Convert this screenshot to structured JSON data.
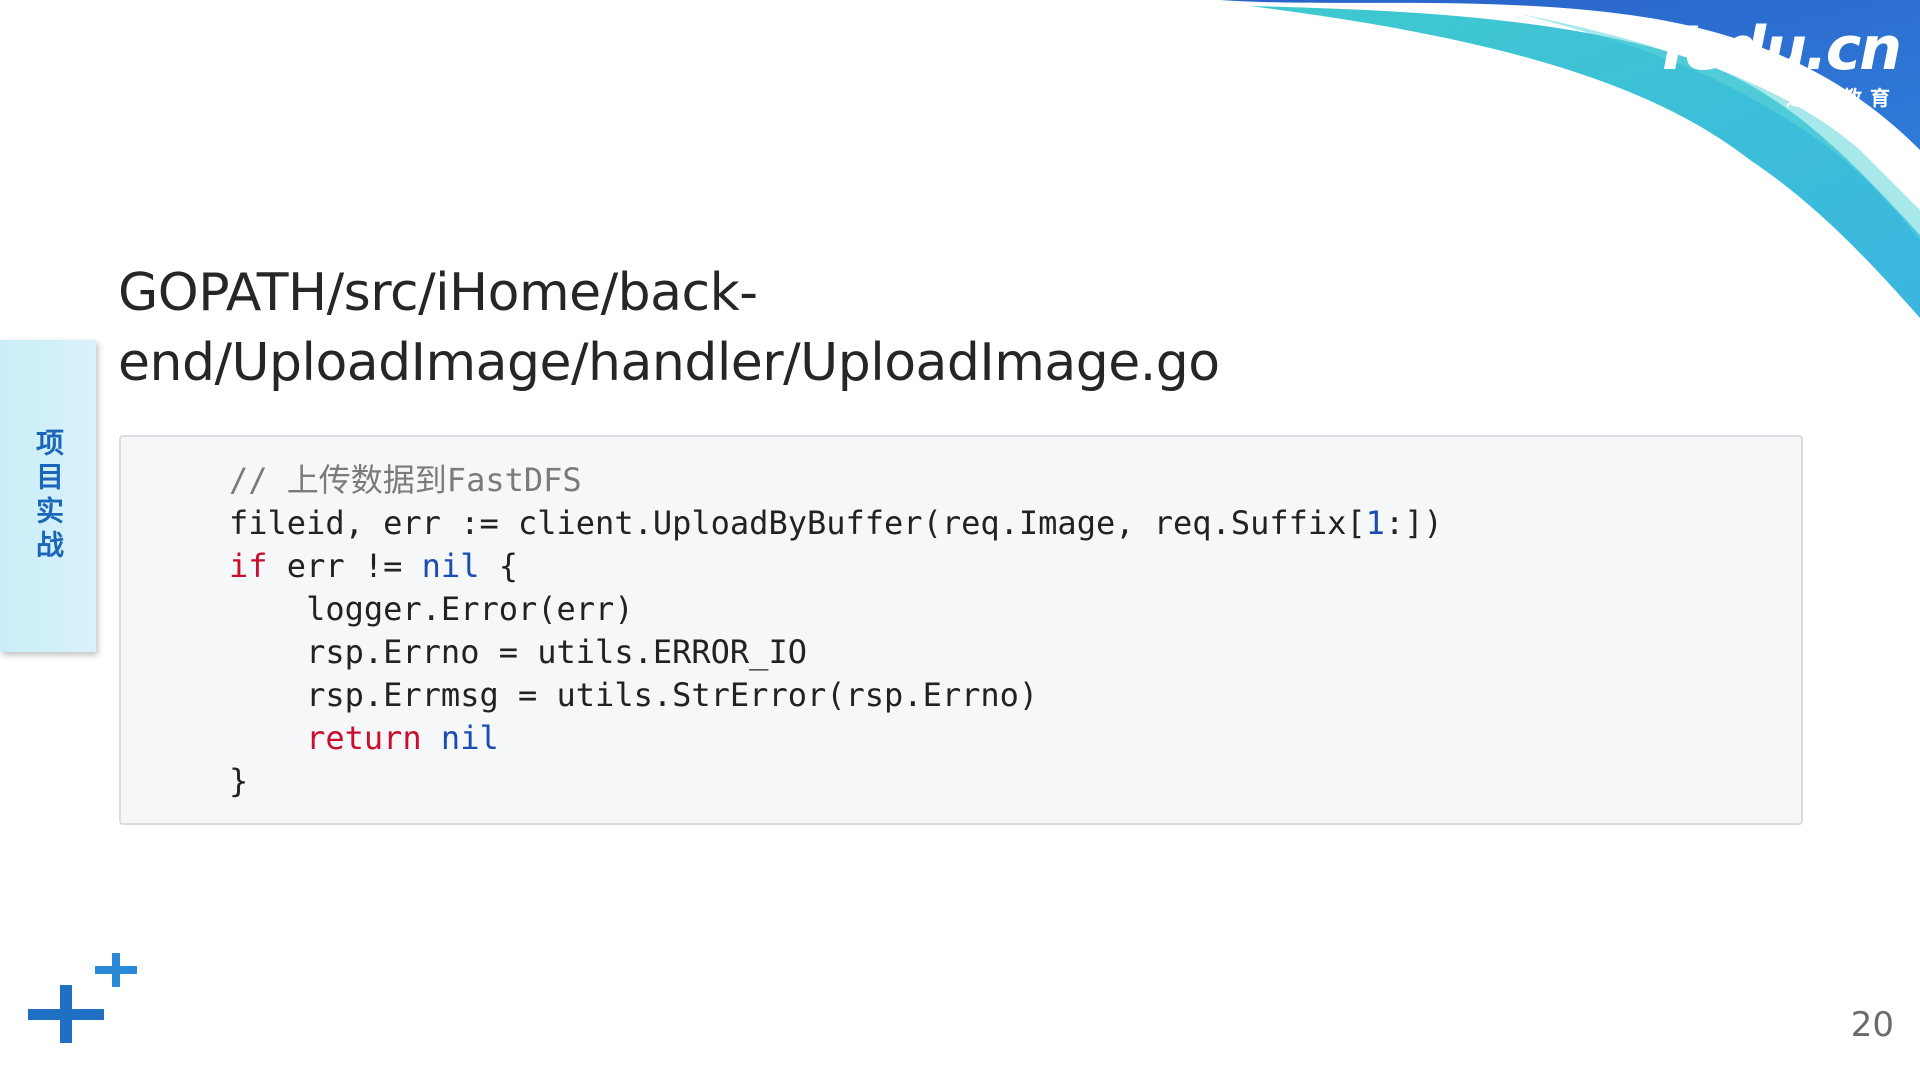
{
  "brand": {
    "logo_text": "Tedu.cn",
    "logo_subtitle": "达内教育",
    "colors": [
      "#2f6fd1",
      "#3ec6d2",
      "#35b8e0"
    ]
  },
  "side_tab": {
    "label": "项目实战",
    "color": "#1b66b8"
  },
  "slide": {
    "title_line1": "GOPATH/src/iHome/back-",
    "title_line2": "end/UploadImage/handler/UploadImage.go",
    "page_number": "20"
  },
  "code": {
    "line1": "// 上传数据到FastDFS",
    "line2_pre": "fileid, err := client.UploadByBuffer(req.Image, req.Suffix[",
    "line2_num": "1",
    "line2_post": ":])",
    "line3_kw": "if",
    "line3_mid": " err != ",
    "line3_nil": "nil",
    "line3_post": " {",
    "line4": "    logger.Error(err)",
    "line5": "    rsp.Errno = utils.ERROR_IO",
    "line6": "    rsp.Errmsg = utils.StrError(rsp.Errno)",
    "line7_indent": "    ",
    "line7_kw": "return",
    "line7_sp": " ",
    "line7_nil": "nil",
    "line8": "}"
  },
  "decorations": {
    "plus_icon_color": "#1f6fc5",
    "plus_small_color": "#2a8ad8"
  }
}
